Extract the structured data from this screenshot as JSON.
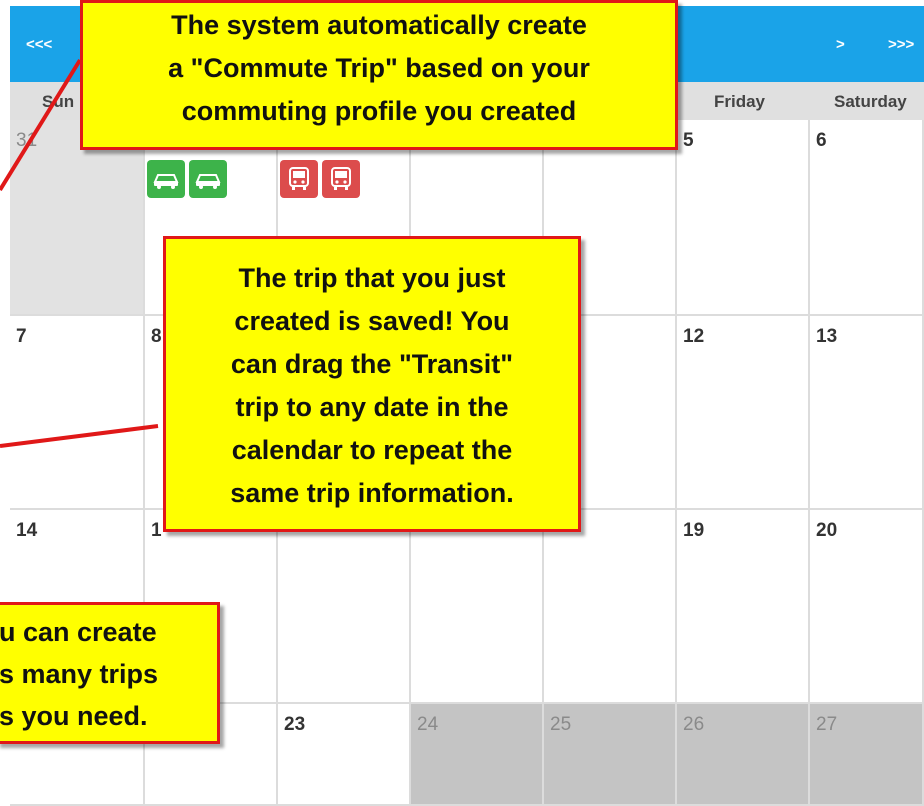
{
  "nav": {
    "prev_year": "<<<",
    "next_month": ">",
    "next_year": ">>>"
  },
  "weekdays": {
    "sun": "Sun",
    "fri": "Friday",
    "sat": "Saturday"
  },
  "days": {
    "r1": [
      "31",
      "5",
      "6"
    ],
    "r2": [
      "7",
      "8",
      "12",
      "13"
    ],
    "r3": [
      "14",
      "1",
      "19",
      "20"
    ],
    "r4": [
      "23",
      "24",
      "25",
      "26",
      "27"
    ]
  },
  "trips": [
    {
      "name": "commute-trip",
      "type": "Commute Trip",
      "icon": "carpool-icon",
      "color": "#3db34a"
    },
    {
      "name": "transit-trip",
      "type": "Transit",
      "icon": "bus-icon",
      "color": "#dc4c4c"
    }
  ],
  "callouts": {
    "top": [
      "The system automatically create",
      "a \"Commute Trip\" based on your",
      "commuting profile you created"
    ],
    "middle": [
      "The trip that you just",
      "created is saved! You",
      "can drag the \"Transit\"",
      "trip to any date in the",
      "calendar to repeat the",
      "same trip information."
    ],
    "bottom": [
      "u can create",
      "s many trips",
      "s you need."
    ]
  },
  "colors": {
    "nav": "#1aa3e8",
    "callout_bg": "#ffff00",
    "callout_border": "#e01818",
    "commute": "#3db34a",
    "transit": "#dc4c4c"
  }
}
